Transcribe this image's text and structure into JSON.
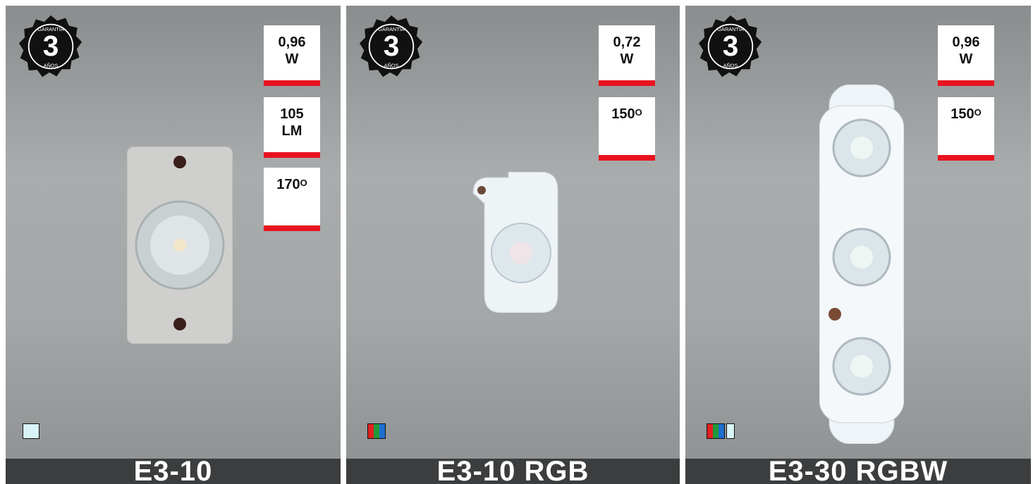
{
  "products": [
    {
      "name": "E3-10",
      "badge": {
        "top": "GARANTÍA",
        "number": "3",
        "bottom": "AÑOS"
      },
      "specs": [
        {
          "value": "0,96",
          "unit": "W"
        },
        {
          "value": "105",
          "unit": "LM"
        },
        {
          "value": "170",
          "unit": "O"
        }
      ],
      "swatch_colors": [
        "#d8f4f6"
      ]
    },
    {
      "name": "E3-10 RGB",
      "badge": {
        "top": "GARANTÍA",
        "number": "3",
        "bottom": "AÑOS"
      },
      "specs": [
        {
          "value": "0,72",
          "unit": "W"
        },
        {
          "value": "150",
          "unit": "O"
        }
      ],
      "swatch_colors": [
        "rgb-gradient"
      ]
    },
    {
      "name": "E3-30 RGBW",
      "badge": {
        "top": "GARANTÍA",
        "number": "3",
        "bottom": "AÑOS"
      },
      "specs": [
        {
          "value": "0,96",
          "unit": "W"
        },
        {
          "value": "150",
          "unit": "O"
        }
      ],
      "swatch_colors": [
        "rgb-gradient",
        "#d8f4f6"
      ]
    }
  ],
  "colors": {
    "accent": "#e8131f",
    "caption_bg": "#3b3d3e"
  }
}
